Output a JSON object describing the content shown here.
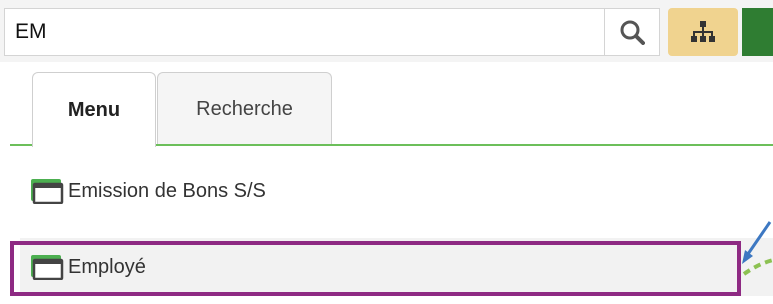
{
  "search": {
    "value": "EM"
  },
  "icons": {
    "search": "search-icon",
    "sitemap": "sitemap-icon",
    "window": "window-icon"
  },
  "tabs": [
    {
      "label": "Menu",
      "active": true
    },
    {
      "label": "Recherche",
      "active": false
    }
  ],
  "menu_items": [
    {
      "label": "Emission de Bons S/S"
    },
    {
      "label": "Employé",
      "highlighted": true
    }
  ],
  "colors": {
    "accent_green": "#6cbf5a",
    "sitemap_button": "#f0d38f",
    "highlight_border": "#8e2a83",
    "annotation_arrow": "#3d78c2"
  }
}
